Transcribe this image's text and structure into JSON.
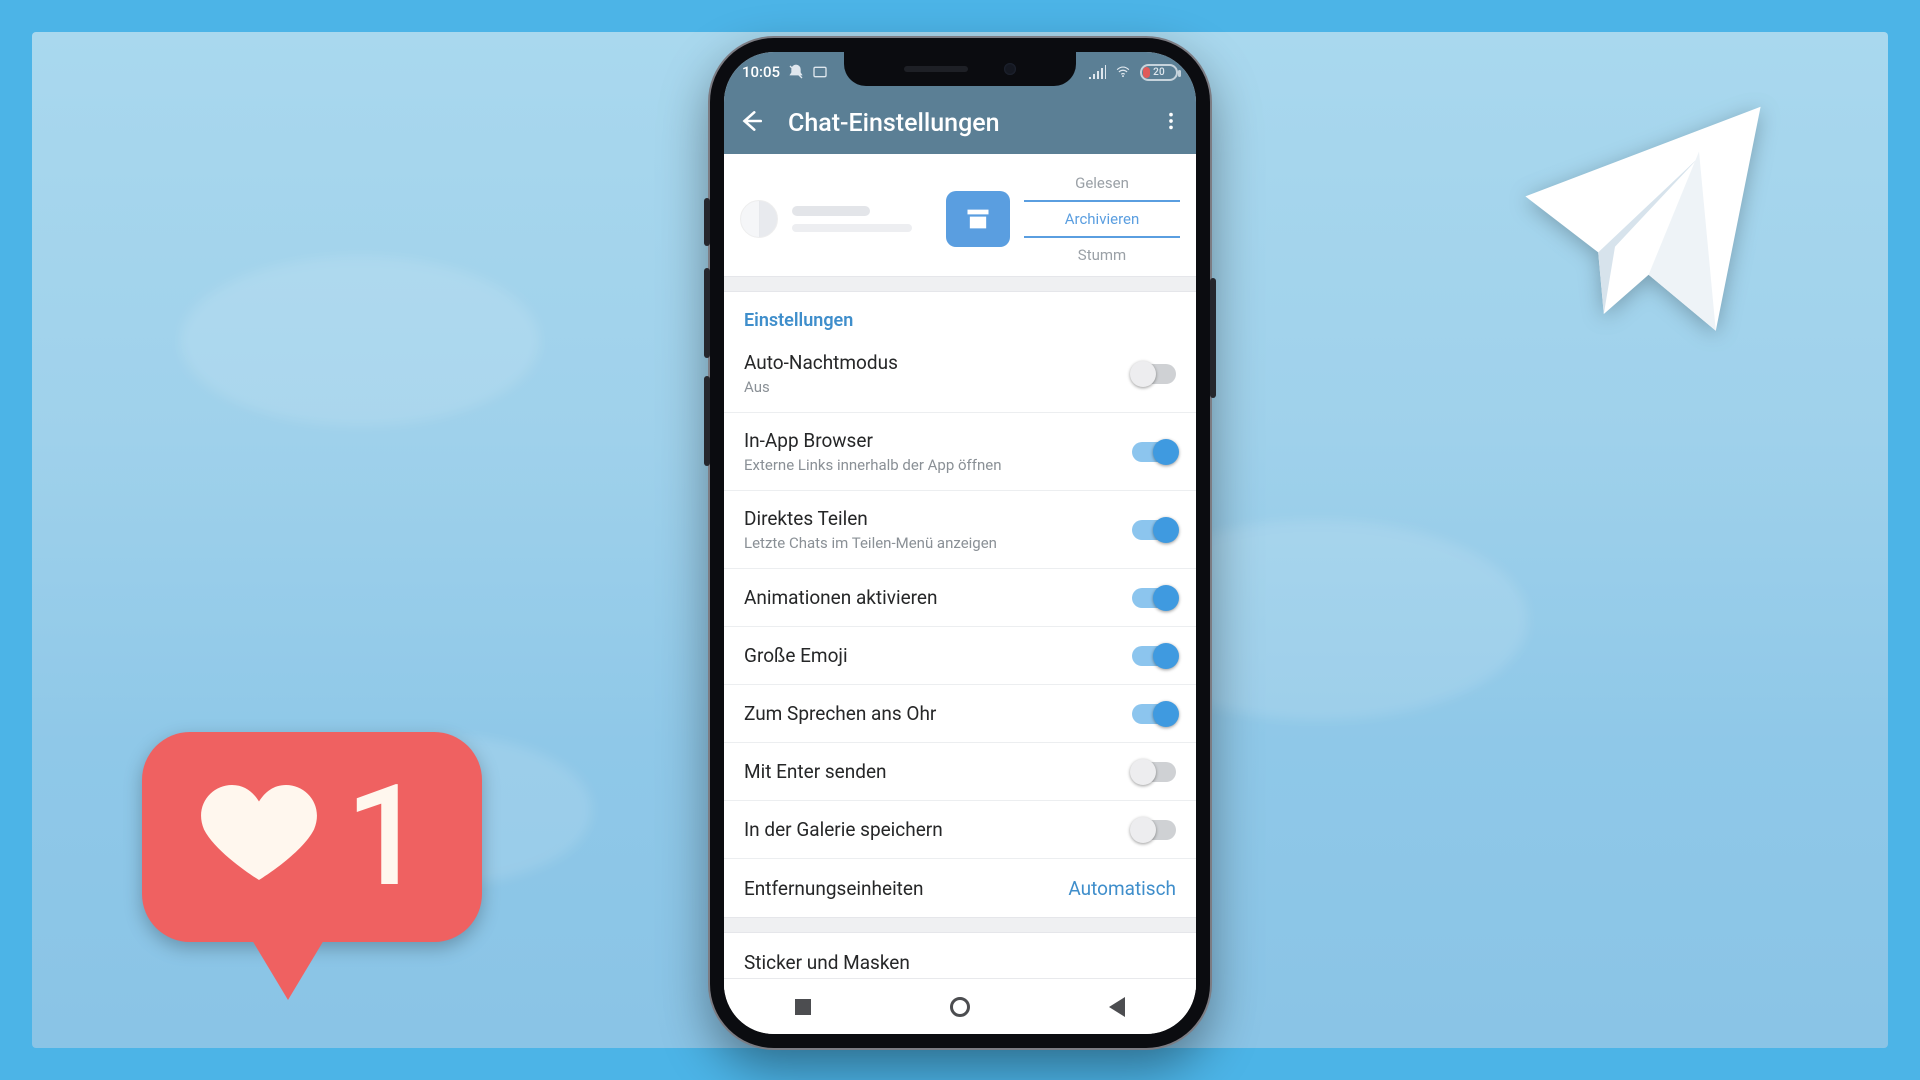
{
  "statusbar": {
    "time": "10:05",
    "battery_text": "20"
  },
  "appbar": {
    "title": "Chat-Einstellungen"
  },
  "swipe_actions": {
    "read": "Gelesen",
    "archive": "Archivieren",
    "mute": "Stumm"
  },
  "section_header": "Einstellungen",
  "settings": {
    "auto_night": {
      "label": "Auto-Nachtmodus",
      "sub": "Aus",
      "on": false
    },
    "in_app_browser": {
      "label": "In-App Browser",
      "sub": "Externe Links innerhalb der App öffnen",
      "on": true
    },
    "direct_share": {
      "label": "Direktes Teilen",
      "sub": "Letzte Chats im Teilen-Menü anzeigen",
      "on": true
    },
    "animations": {
      "label": "Animationen aktivieren",
      "on": true
    },
    "large_emoji": {
      "label": "Große Emoji",
      "on": true
    },
    "raise_to_speak": {
      "label": "Zum Sprechen ans Ohr",
      "on": true
    },
    "send_enter": {
      "label": "Mit Enter senden",
      "on": false
    },
    "save_gallery": {
      "label": "In der Galerie speichern",
      "on": false
    },
    "distance_units": {
      "label": "Entfernungseinheiten",
      "value": "Automatisch"
    },
    "stickers_masks": {
      "label": "Sticker und Masken"
    }
  },
  "like_badge": {
    "count": "1"
  },
  "colors": {
    "accent": "#3f8ecb",
    "header": "#5b7f95",
    "toggle_on": "#3f9ae0"
  }
}
